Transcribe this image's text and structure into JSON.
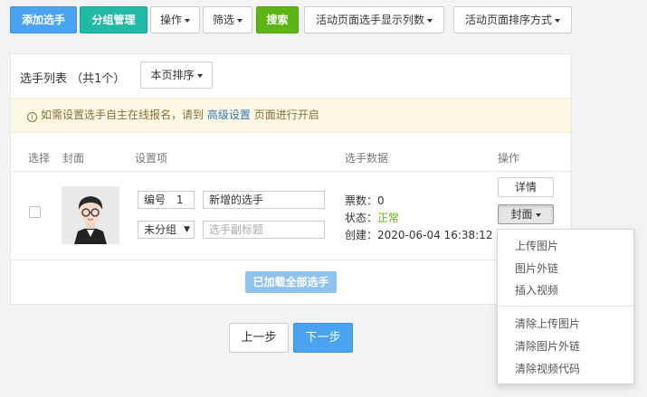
{
  "toolbar": {
    "add_player": "添加选手",
    "group_manage": "分组管理",
    "operations": "操作",
    "filter": "筛选",
    "search": "搜索",
    "columns": "活动页面选手显示列数",
    "sort_mode": "活动页面排序方式"
  },
  "panel": {
    "title_label": "选手列表",
    "count": "（共1个）",
    "page_sort": "本页排序"
  },
  "notice": {
    "prefix": "如需设置选手自主在线报名，请到",
    "link": "高级设置",
    "suffix": "页面进行开启"
  },
  "table": {
    "headers": [
      "选择",
      "封面",
      "设置项",
      "选手数据",
      "操作"
    ]
  },
  "row": {
    "number_label": "编号",
    "number_value": "1",
    "name_value": "新增的选手",
    "group_value": "未分组",
    "subtitle_placeholder": "选手副标题",
    "votes": "票数：0",
    "status_label": "状态：",
    "status_value": "正常",
    "created": "创建：2020-06-04 16:38:12",
    "detail_btn": "详情",
    "cover_btn": "封面"
  },
  "loaded_all": "已加载全部选手",
  "cover_menu": {
    "items": [
      "上传图片",
      "图片外链",
      "插入视频",
      "清除上传图片",
      "清除图片外链",
      "清除视频代码"
    ]
  },
  "nav": {
    "prev": "上一步",
    "next": "下一步"
  },
  "colors": {
    "primary": "#4aa3f0",
    "teal": "#1fbba6",
    "green": "#5cb514",
    "notice_bg": "#fcf8e3"
  }
}
